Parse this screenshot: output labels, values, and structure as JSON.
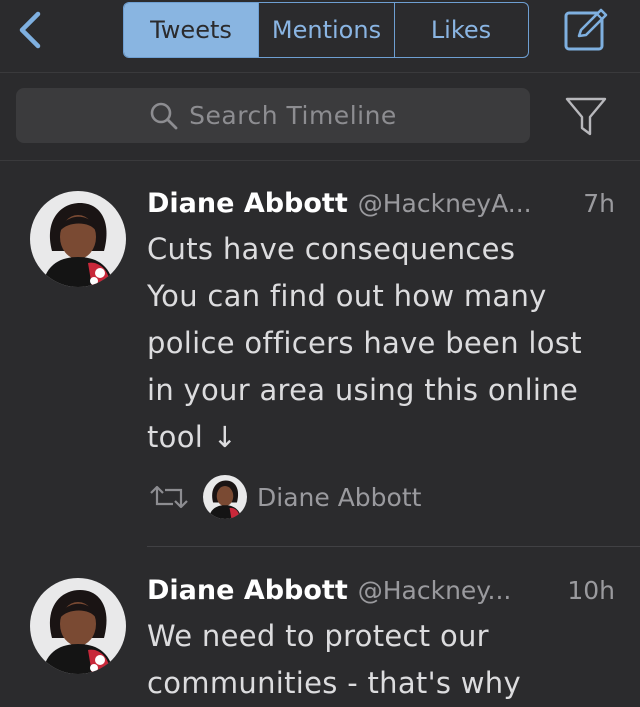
{
  "nav": {
    "tabs": [
      {
        "label": "Tweets",
        "active": true
      },
      {
        "label": "Mentions",
        "active": false
      },
      {
        "label": "Likes",
        "active": false
      }
    ]
  },
  "search": {
    "placeholder": "Search Timeline"
  },
  "tweets": [
    {
      "name": "Diane Abbott",
      "handle": "@HackneyA...",
      "time": "7h",
      "lines": [
        "Cuts have consequences",
        "You can find out how many",
        "police officers have been lost",
        "in your area using this online",
        "tool ↓"
      ],
      "retweeted_by": "Diane Abbott"
    },
    {
      "name": "Diane Abbott",
      "handle": "@Hackney...",
      "time": "10h",
      "lines": [
        "We need to protect our",
        "communities - that's why"
      ]
    }
  ],
  "colors": {
    "background": "#2b2b2d",
    "accent": "#89b5e1",
    "secondary_text": "#9a9a9e"
  }
}
